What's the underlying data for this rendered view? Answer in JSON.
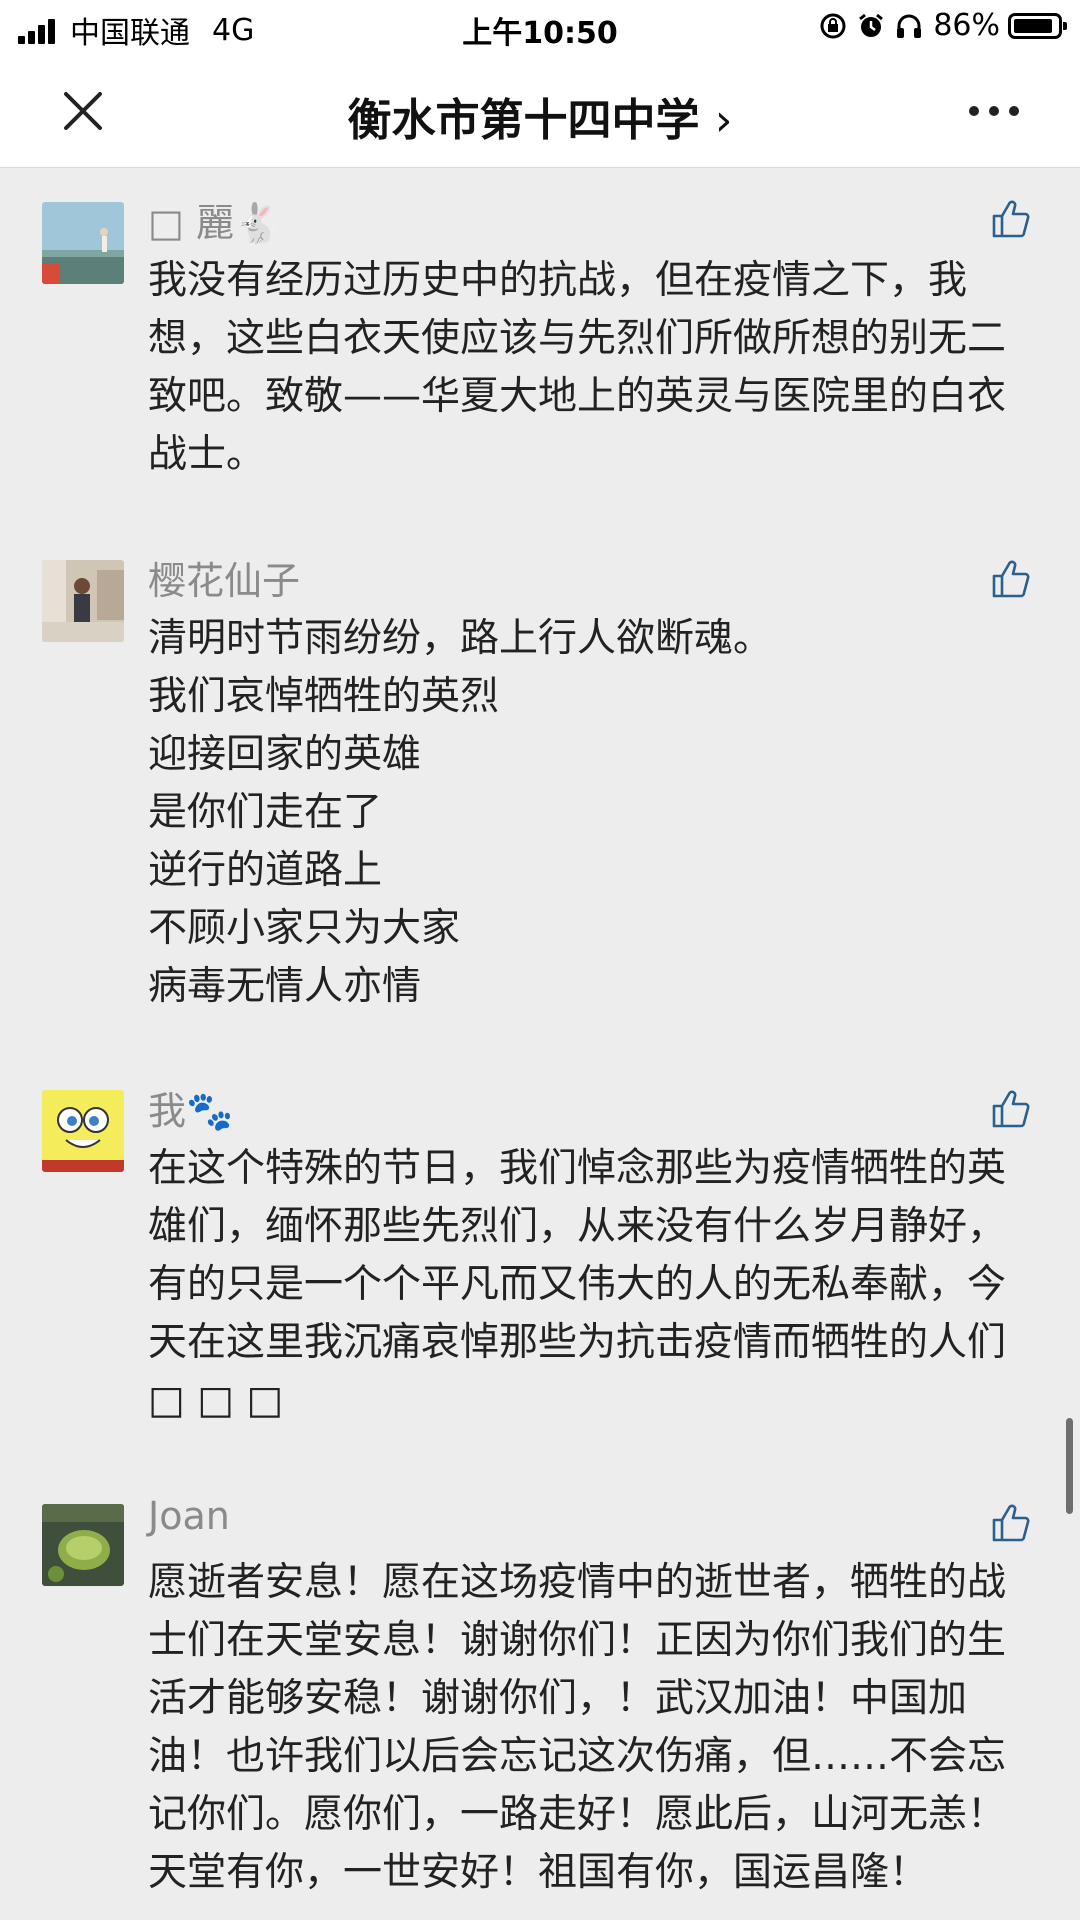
{
  "status_bar": {
    "carrier": "中国联通",
    "network": "4G",
    "time": "上午10:50",
    "battery": "86%"
  },
  "nav": {
    "title": "衡水市第十四中学",
    "chevron": "›",
    "close_icon": "close-icon",
    "more_icon": "more-icon"
  },
  "colors": {
    "background": "#ededed",
    "name_gray": "#8a8a8a",
    "like_icon": "#2b5f8c"
  },
  "comments": [
    {
      "name": "□ 麗🐇",
      "text": "我没有经历过历史中的抗战，但在疫情之下，我想，这些白衣天使应该与先烈们所做所想的别无二致吧。致敬——华夏大地上的英灵与医院里的白衣战士。"
    },
    {
      "name": "樱花仙子",
      "text": "清明时节雨纷纷，路上行人欲断魂。\n我们哀悼牺牲的英烈\n迎接回家的英雄\n是你们走在了\n逆行的道路上\n不顾小家只为大家\n病毒无情人亦情"
    },
    {
      "name": "我🐾",
      "text": "在这个特殊的节日，我们悼念那些为疫情牺牲的英雄们，缅怀那些先烈们，从来没有什么岁月静好，有的只是一个个平凡而又伟大的人的无私奉献，今天在这里我沉痛哀悼那些为抗击疫情而牺牲的人们□ □ □"
    },
    {
      "name": "Joan",
      "text": "愿逝者安息！愿在这场疫情中的逝世者，牺牲的战士们在天堂安息！谢谢你们！正因为你们我们的生活才能够安稳！谢谢你们，！武汉加油！中国加油！也许我们以后会忘记这次伤痛，但……不会忘记你们。愿你们，一路走好！愿此后，山河无恙！天堂有你，一世安好！祖国有你，国运昌隆！"
    }
  ]
}
